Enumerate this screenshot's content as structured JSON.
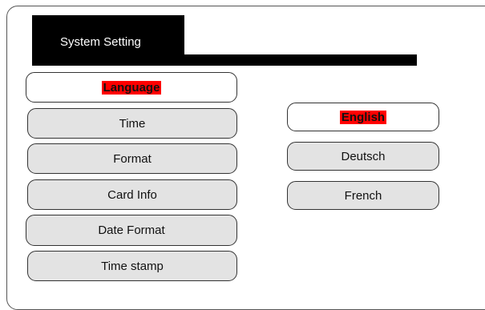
{
  "header": {
    "title": "System Setting"
  },
  "menu": {
    "items": [
      {
        "label": "Language"
      },
      {
        "label": "Time"
      },
      {
        "label": "Format"
      },
      {
        "label": "Card Info"
      },
      {
        "label": "Date Format"
      },
      {
        "label": "Time stamp"
      }
    ]
  },
  "options": {
    "items": [
      {
        "label": "English"
      },
      {
        "label": "Deutsch"
      },
      {
        "label": "French"
      }
    ]
  },
  "colors": {
    "highlight": "#ff0000",
    "title_background": "#000000",
    "button_background": "#e3e3e3"
  }
}
